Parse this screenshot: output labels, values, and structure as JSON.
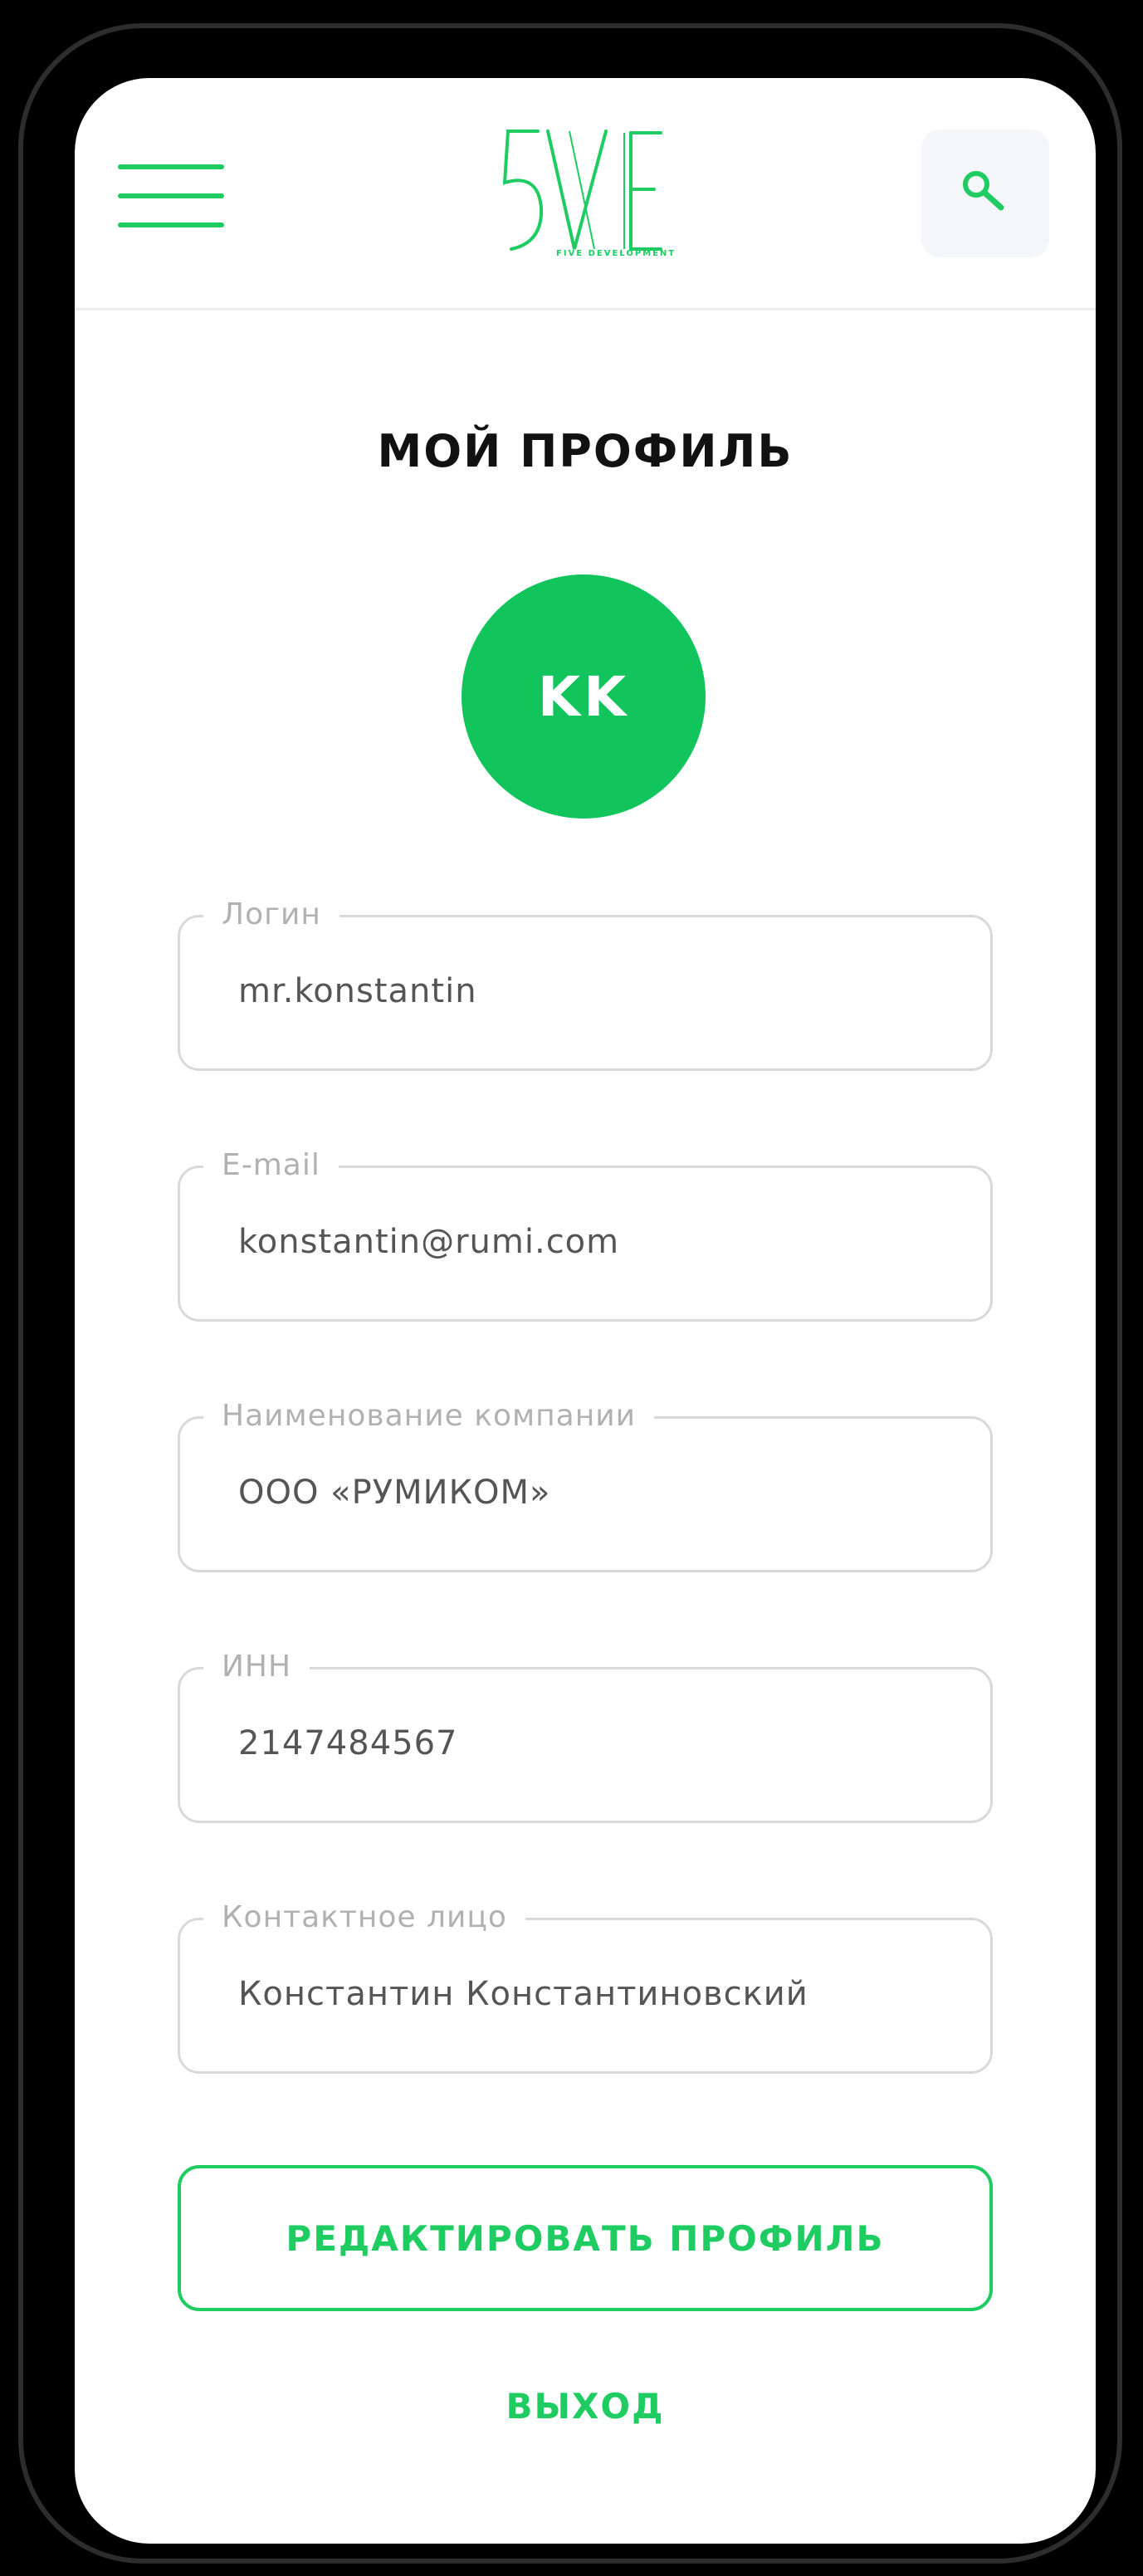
{
  "header": {
    "logo_text": "5VE",
    "logo_subtext": "FIVE DEVELOPMENT",
    "menu_icon": "hamburger-menu-icon",
    "search_icon": "search-icon",
    "accent_color": "#1fcc62"
  },
  "page": {
    "title": "МОЙ ПРОФИЛЬ"
  },
  "avatar": {
    "initials": "KK",
    "color": "#12c45c"
  },
  "fields": [
    {
      "label": "Логин",
      "value": "mr.konstantin"
    },
    {
      "label": "E-mail",
      "value": "konstantin@rumi.com"
    },
    {
      "label": "Наименование компании",
      "value": "ООО «РУМИКОМ»"
    },
    {
      "label": "ИНН",
      "value": "2147484567"
    },
    {
      "label": "Контактное лицо",
      "value": "Константин Константиновский"
    }
  ],
  "actions": {
    "edit_label": "РЕДАКТИРОВАТЬ ПРОФИЛЬ",
    "logout_label": "ВЫХОД"
  }
}
